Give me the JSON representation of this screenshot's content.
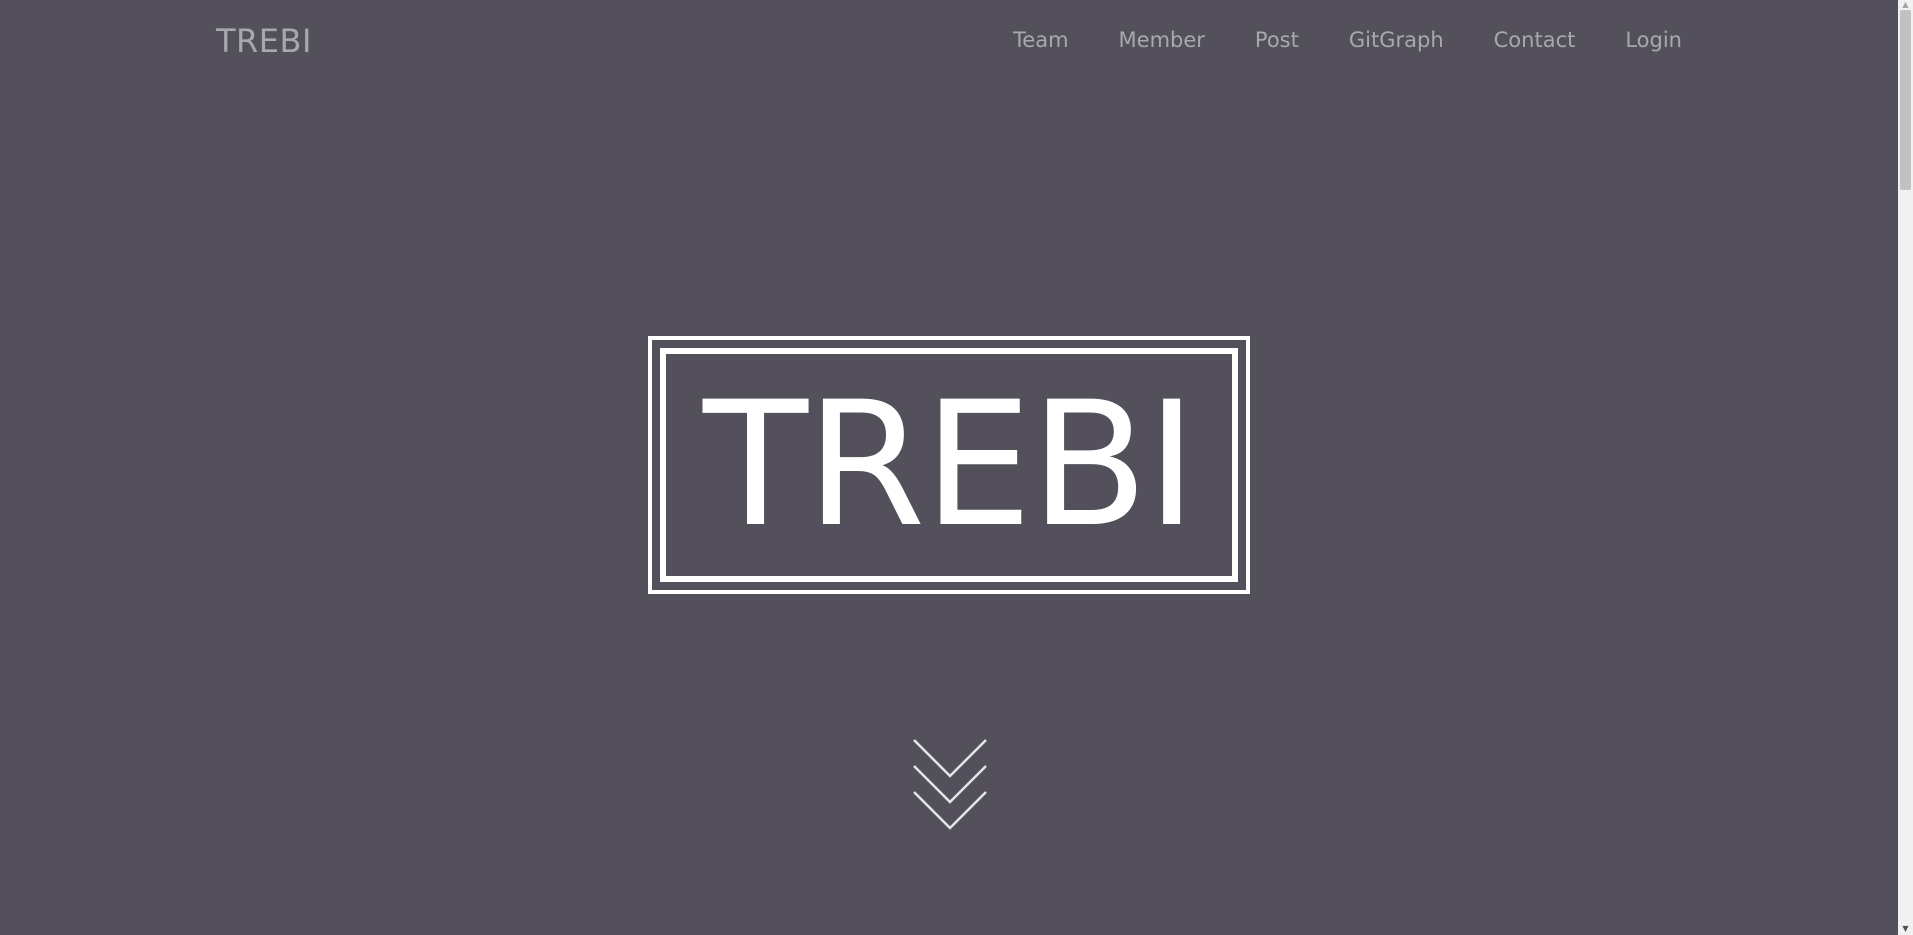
{
  "navbar": {
    "brand": "TREBI",
    "links": [
      {
        "label": "Team"
      },
      {
        "label": "Member"
      },
      {
        "label": "Post"
      },
      {
        "label": "GitGraph"
      },
      {
        "label": "Contact"
      },
      {
        "label": "Login"
      }
    ]
  },
  "hero": {
    "title": "TREBI"
  },
  "scroll_indicator": {
    "icon": "triple-chevron-down-icon"
  },
  "colors": {
    "background": "#53505c",
    "nav_text": "#a9a7ae",
    "hero_text": "#ffffff"
  }
}
